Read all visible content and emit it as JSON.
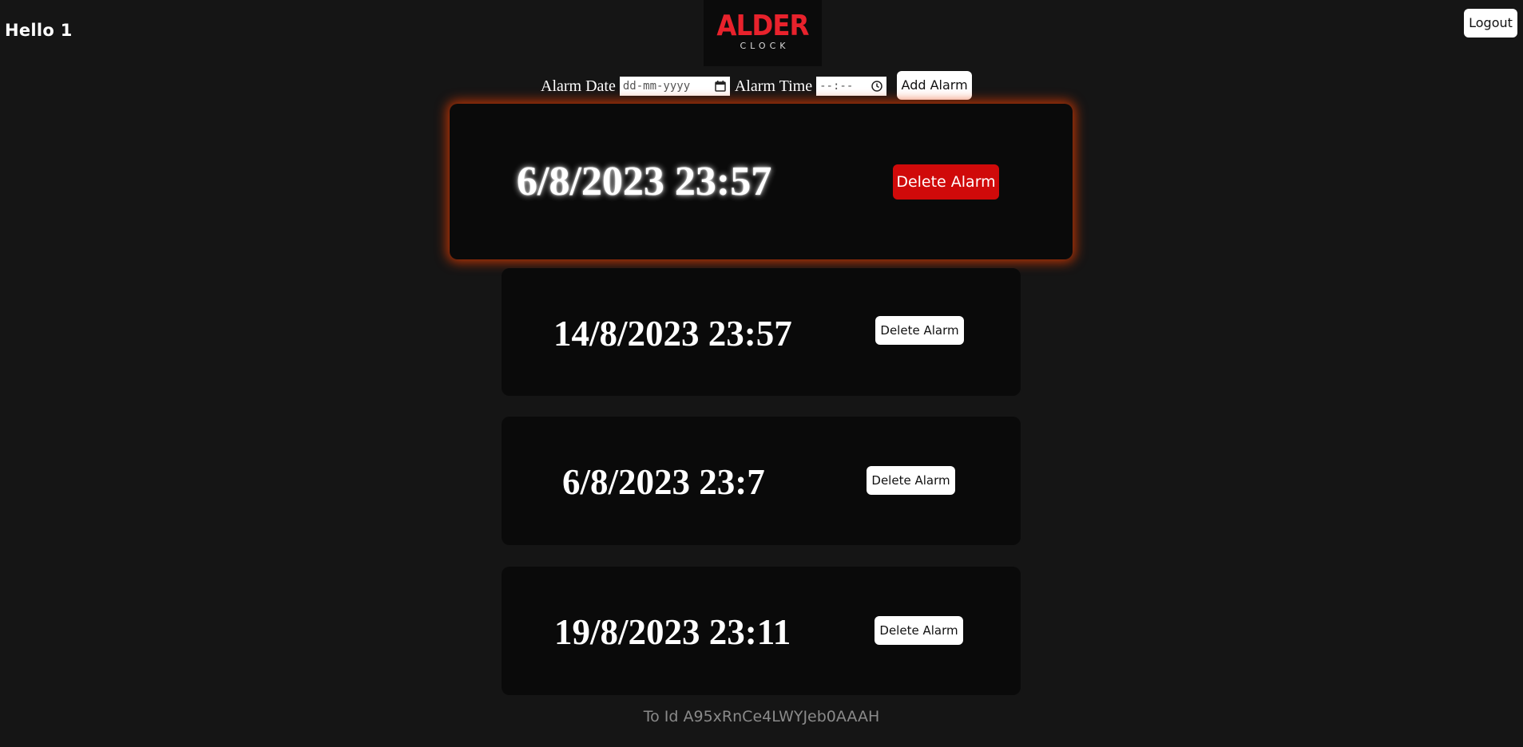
{
  "header": {
    "greeting": "Hello 1",
    "logo_main": "ALDER",
    "logo_sub": "CLOCK",
    "logout_label": "Logout"
  },
  "form": {
    "date_label": "Alarm Date",
    "date_placeholder": "dd-mm-yyyy",
    "time_label": "Alarm Time",
    "time_placeholder": "--:--",
    "add_label": "Add Alarm"
  },
  "alarms": [
    {
      "datetime": "6/8/2023 23:57",
      "delete_label": "Delete Alarm",
      "active": true
    },
    {
      "datetime": "14/8/2023 23:57",
      "delete_label": "Delete Alarm",
      "active": false
    },
    {
      "datetime": "6/8/2023 23:7",
      "delete_label": "Delete Alarm",
      "active": false
    },
    {
      "datetime": "19/8/2023 23:11",
      "delete_label": "Delete Alarm",
      "active": false
    }
  ],
  "footer": {
    "to_id": "To Id A95xRnCe4LWYJeb0AAAH"
  },
  "colors": {
    "background": "#151515",
    "card": "#0a0a0a",
    "accent_red": "#d00a0a",
    "logo_red": "#e8222c",
    "glow": "#e63c00"
  }
}
